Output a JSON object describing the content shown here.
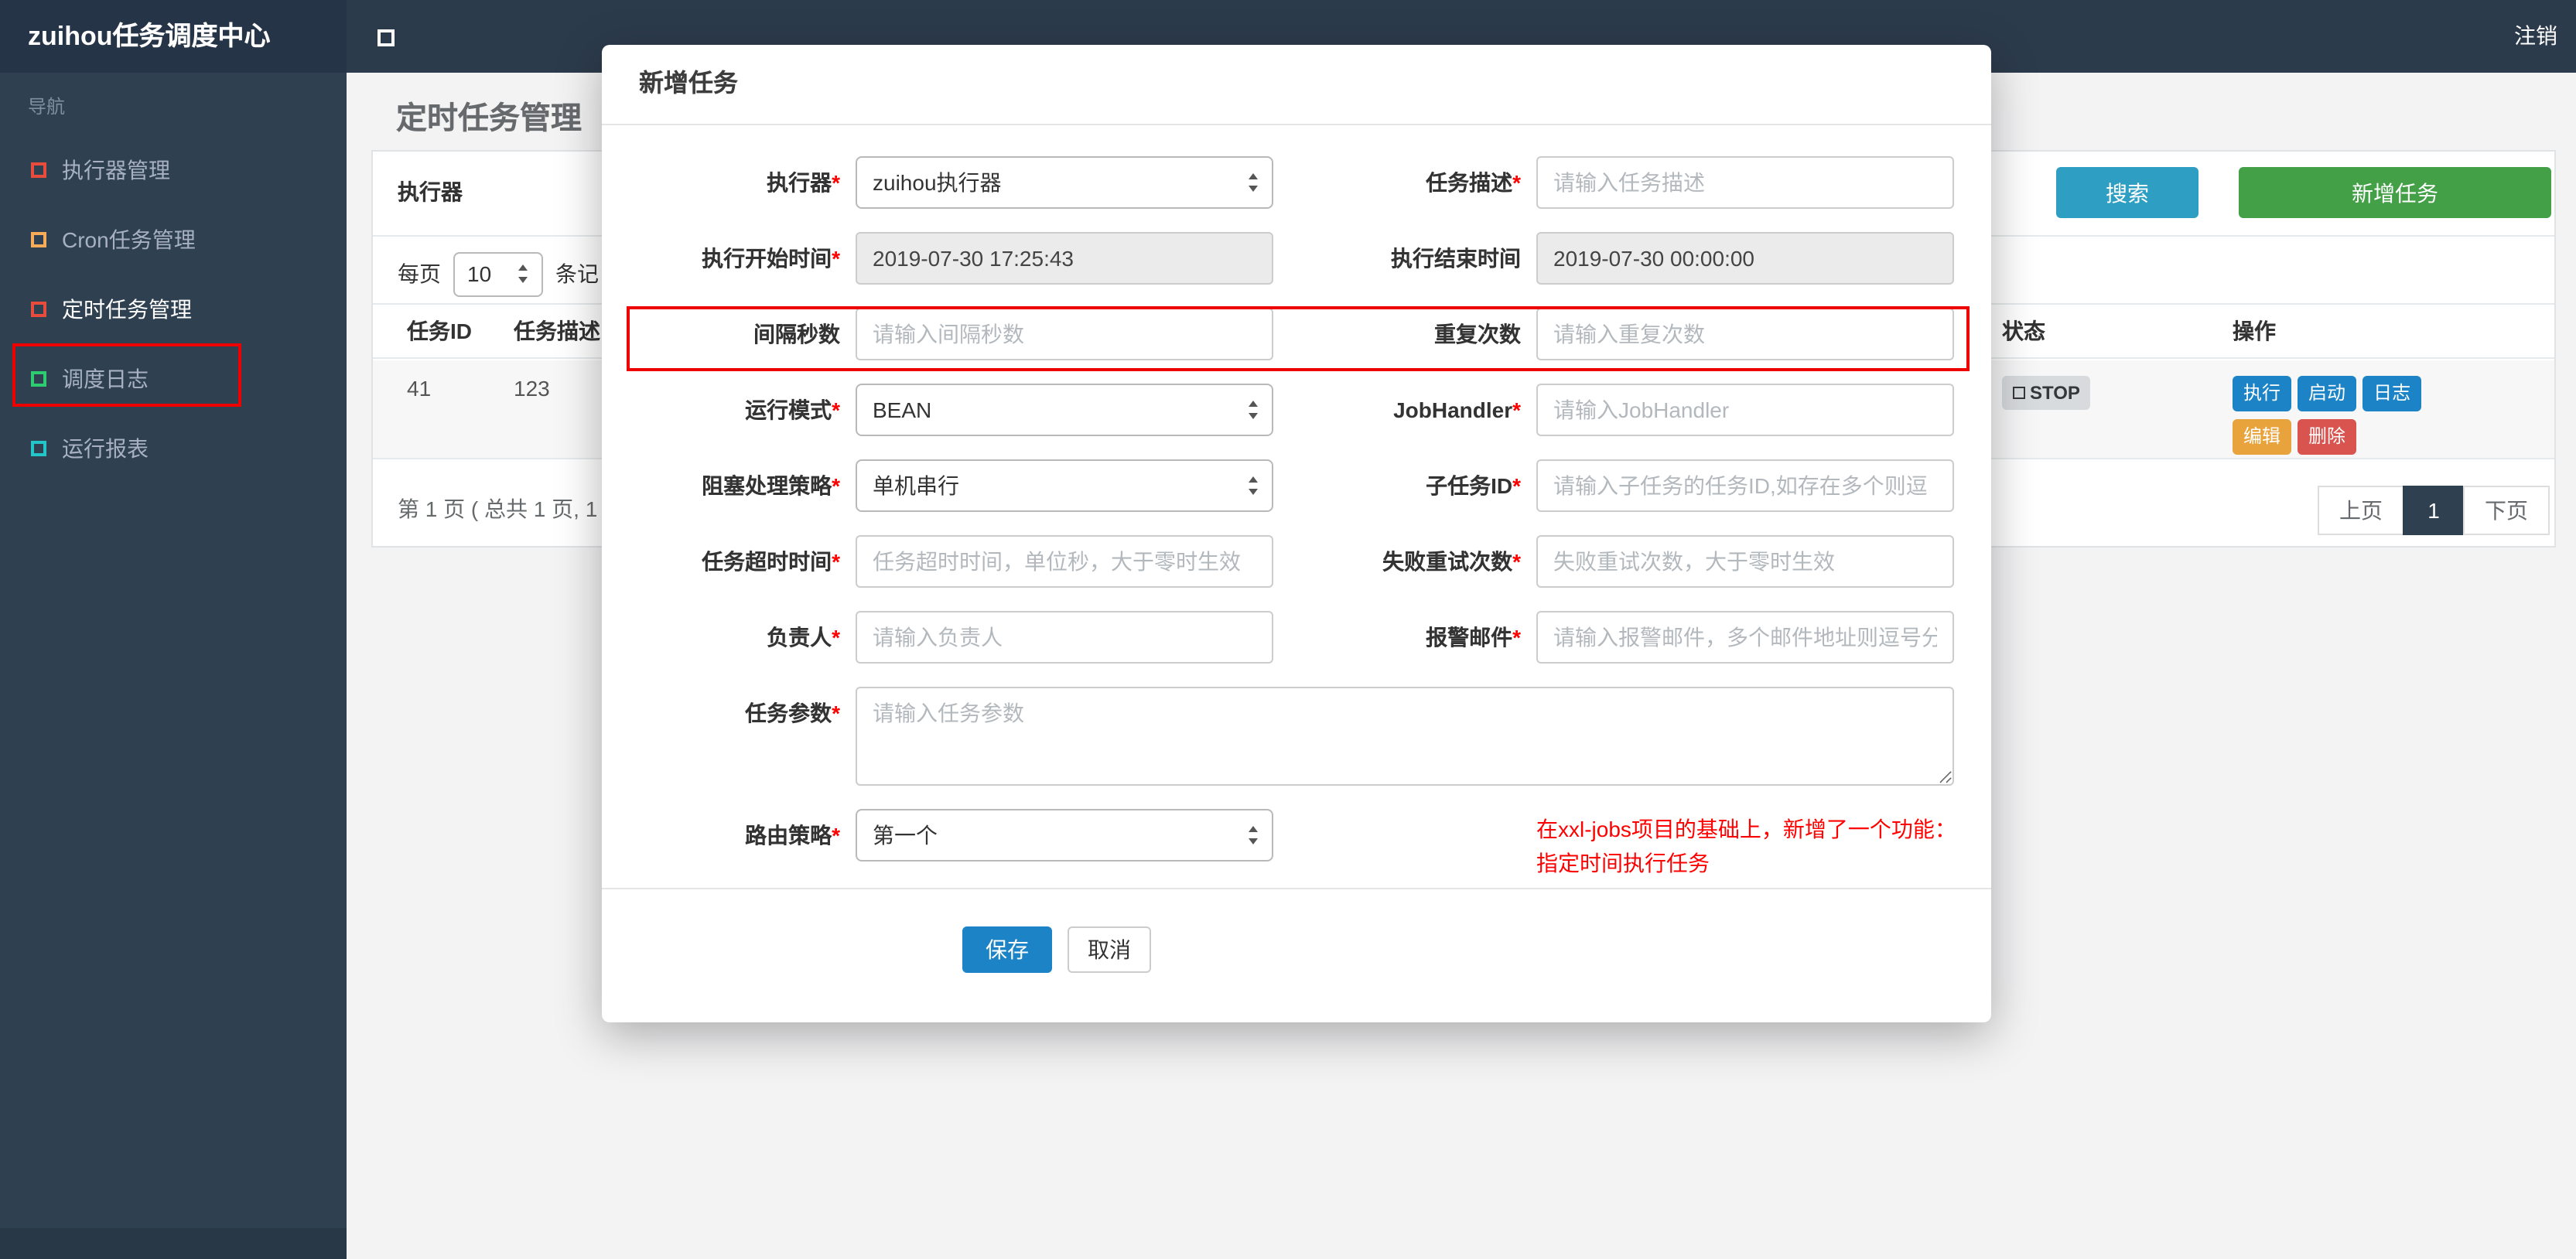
{
  "navbar": {
    "brand": "zuihou任务调度中心",
    "logout": "注销"
  },
  "sidebar": {
    "section_label": "导航",
    "items": [
      {
        "label": "执行器管理",
        "icon_color": "#e74c3c",
        "active": false
      },
      {
        "label": "Cron任务管理",
        "icon_color": "#f8ac59",
        "active": false
      },
      {
        "label": "定时任务管理",
        "icon_color": "#e74c3c",
        "active": true
      },
      {
        "label": "调度日志",
        "icon_color": "#2ecc71",
        "active": false
      },
      {
        "label": "运行报表",
        "icon_color": "#23c6c8",
        "active": false
      }
    ]
  },
  "page": {
    "title": "定时任务管理",
    "filter": {
      "executor_label": "执行器",
      "search_button": "搜索",
      "add_button": "新增任务"
    },
    "per_page": {
      "prefix": "每页",
      "value": "10",
      "suffix": "条记"
    },
    "table": {
      "headers": {
        "id": "任务ID",
        "desc": "任务描述",
        "status": "状态",
        "actions": "操作"
      },
      "row": {
        "id": "41",
        "desc": "123",
        "status": "STOP",
        "action_execute": "执行",
        "action_start": "启动",
        "action_log": "日志",
        "action_edit": "编辑",
        "action_delete": "删除"
      }
    },
    "pagination": {
      "summary": "第 1 页 ( 总共 1 页, 1",
      "prev": "上页",
      "page": "1",
      "next": "下页"
    }
  },
  "modal": {
    "title": "新增任务",
    "required_marker": "*",
    "rows": [
      {
        "left": {
          "label": "执行器",
          "required": true,
          "value": "zuihou执行器"
        },
        "right": {
          "label": "任务描述",
          "required": true,
          "placeholder": "请输入任务描述"
        }
      },
      {
        "left": {
          "label": "执行开始时间",
          "required": true,
          "value": "2019-07-30 17:25:43"
        },
        "right": {
          "label": "执行结束时间",
          "required": false,
          "value": "2019-07-30 00:00:00"
        }
      },
      {
        "left": {
          "label": "间隔秒数",
          "required": false,
          "placeholder": "请输入间隔秒数"
        },
        "right": {
          "label": "重复次数",
          "required": false,
          "placeholder": "请输入重复次数"
        }
      },
      {
        "left": {
          "label": "运行模式",
          "required": true,
          "value": "BEAN"
        },
        "right": {
          "label": "JobHandler",
          "required": true,
          "placeholder": "请输入JobHandler"
        }
      },
      {
        "left": {
          "label": "阻塞处理策略",
          "required": true,
          "value": "单机串行"
        },
        "right": {
          "label": "子任务ID",
          "required": true,
          "placeholder": "请输入子任务的任务ID,如存在多个则逗"
        }
      },
      {
        "left": {
          "label": "任务超时时间",
          "required": true,
          "placeholder": "任务超时时间，单位秒，大于零时生效"
        },
        "right": {
          "label": "失败重试次数",
          "required": true,
          "placeholder": "失败重试次数，大于零时生效"
        }
      },
      {
        "left": {
          "label": "负责人",
          "required": true,
          "placeholder": "请输入负责人"
        },
        "right": {
          "label": "报警邮件",
          "required": true,
          "placeholder": "请输入报警邮件，多个邮件地址则逗号分"
        }
      },
      {
        "left": {
          "label": "任务参数",
          "required": true,
          "placeholder": "请输入任务参数"
        }
      },
      {
        "left": {
          "label": "路由策略",
          "required": true,
          "value": "第一个"
        }
      }
    ],
    "note_line1": "在xxl-jobs项目的基础上，新增了一个功能：",
    "note_line2": "指定时间执行任务",
    "save_button": "保存",
    "cancel_button": "取消"
  },
  "colors": {
    "topbar": "#2c3b4c",
    "sidebar": "#2f4050",
    "search_button": "#2e9fc2",
    "add_button": "#43a047",
    "primary_button": "#1c84c6",
    "edit_button": "#e8a33d",
    "delete_button": "#d9534f",
    "annotation": "#ee0000",
    "note_text": "#ff0000"
  }
}
